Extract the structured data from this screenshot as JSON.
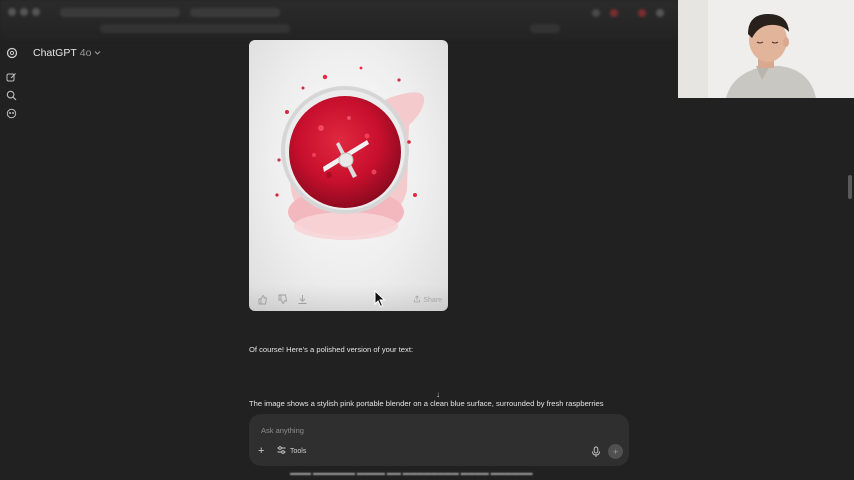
{
  "model": {
    "name": "ChatGPT",
    "version": "4o"
  },
  "image_card": {
    "share_label": "Share"
  },
  "messages": {
    "intro": "Of course! Here’s a polished version of your text:",
    "description": "The image shows a stylish pink portable blender on a clean blue surface, surrounded by fresh raspberries"
  },
  "composer": {
    "placeholder": "Ask anything",
    "tools_label": "Tools"
  },
  "colors": {
    "background": "#212121",
    "composer": "#2f2f2f",
    "smoothie": "#c8102e",
    "blender": "#f2b8be"
  }
}
